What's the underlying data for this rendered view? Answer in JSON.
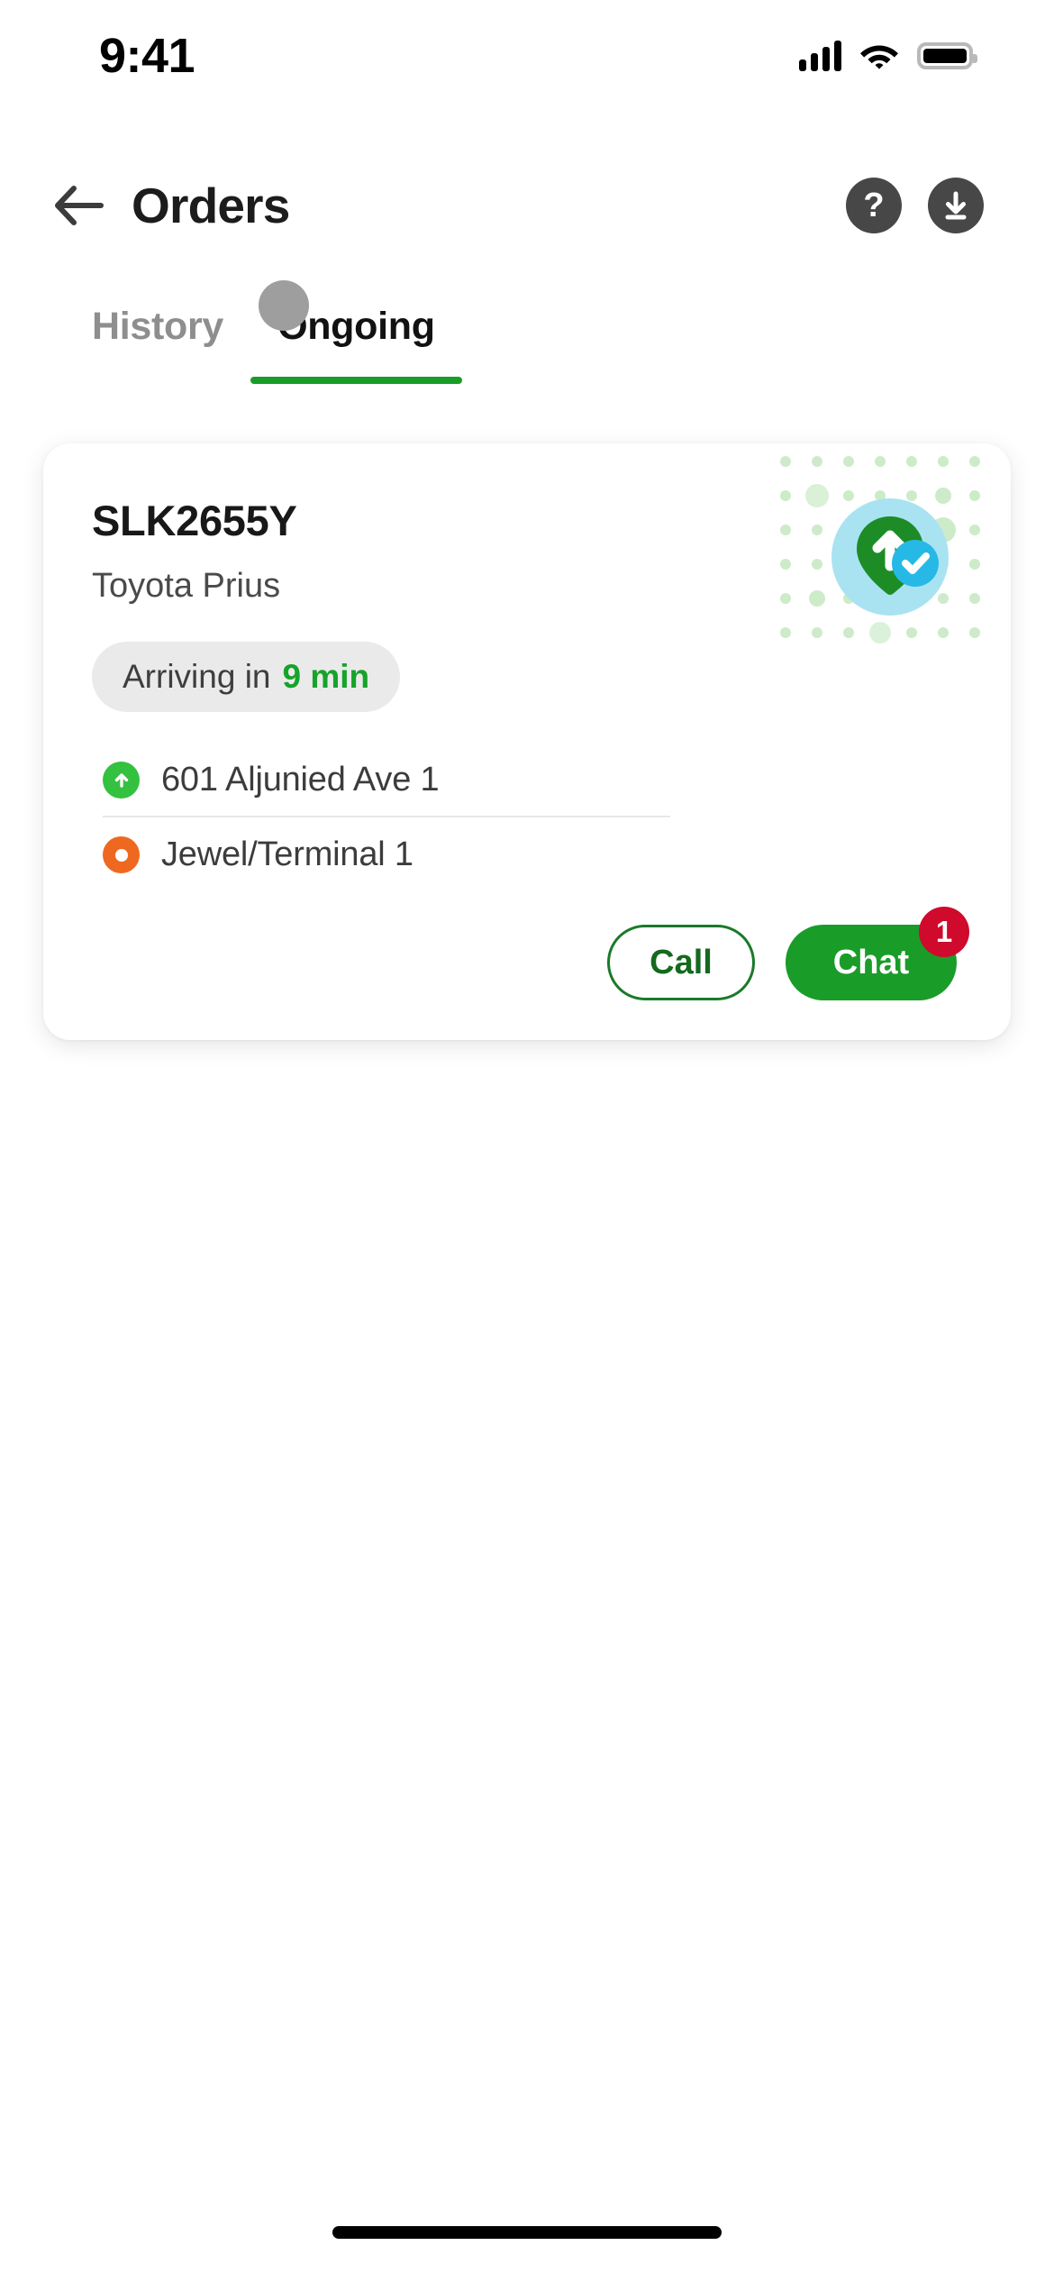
{
  "status_bar": {
    "time": "9:41",
    "signal_icon": "cellular-signal-icon",
    "wifi_icon": "wifi-icon",
    "battery_icon": "battery-full-icon"
  },
  "header": {
    "back_icon": "back-arrow-icon",
    "title": "Orders",
    "help_label": "?",
    "help_icon": "help-question-icon",
    "download_icon": "download-icon"
  },
  "tabs": {
    "items": [
      {
        "label": "History",
        "active": false
      },
      {
        "label": "Ongoing",
        "active": true
      }
    ],
    "active_index": 1,
    "indicator_color": "#1a9c29"
  },
  "order_card": {
    "plate": "SLK2655Y",
    "vehicle": "Toyota Prius",
    "eta": {
      "prefix": "Arriving in",
      "value": "9 min",
      "value_color": "#16a32a",
      "pill_background": "#eaeaea"
    },
    "route": [
      {
        "icon": "pickup-arrow-icon",
        "icon_color": "#33c13f",
        "address": "601 Aljunied Ave 1",
        "type": "pickup"
      },
      {
        "icon": "dropoff-dot-icon",
        "icon_color": "#ef6820",
        "address": "Jewel/Terminal 1",
        "type": "dropoff"
      }
    ],
    "actions": {
      "call_label": "Call",
      "chat_label": "Chat",
      "chat_badge_count": "1",
      "chat_badge_color": "#cf0a2c",
      "chat_background": "#1a9c29",
      "call_border_color": "#1a7a2a"
    },
    "illustration": {
      "name": "location-verified-illustration",
      "pin_color": "#1d8c26",
      "halo_color": "#a9e3f2",
      "check_color": "#27b9e6",
      "dot_color": "#c8ebc4"
    }
  },
  "home_indicator": {
    "name": "home-indicator"
  }
}
